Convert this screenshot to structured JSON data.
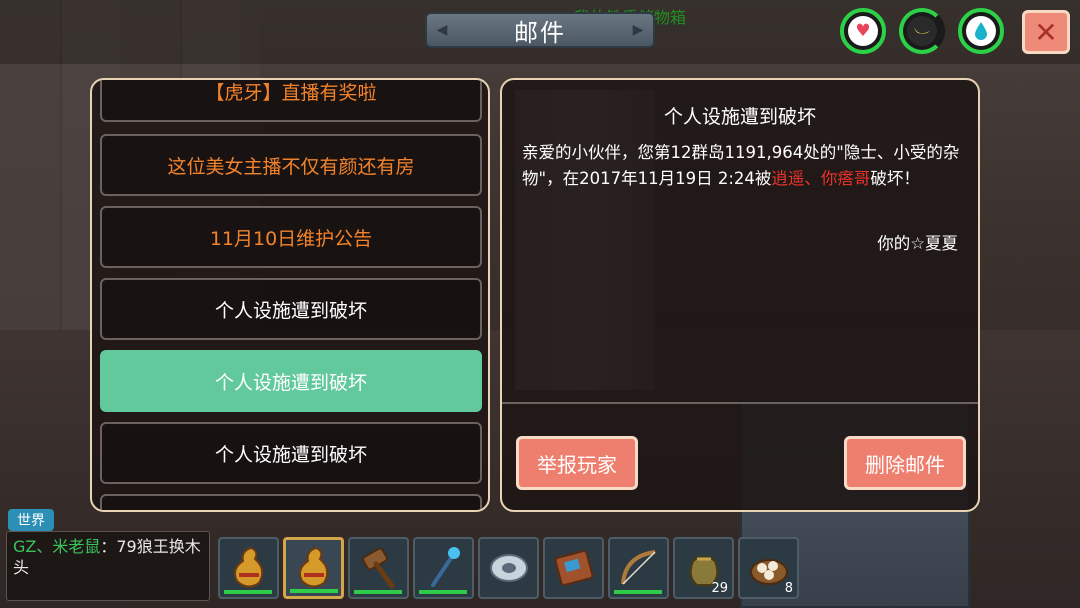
{
  "scene": {
    "storage_label": "我的铁质储物箱"
  },
  "header": {
    "title": "邮件"
  },
  "status_icons": [
    "heart-icon",
    "banana-icon",
    "water-drop-icon"
  ],
  "close_icon": "close-icon",
  "mail_list": [
    {
      "subject": "【虎牙】直播有奖啦",
      "color": "#f3832a"
    },
    {
      "subject": "这位美女主播不仅有颜还有房",
      "color": "#f3832a"
    },
    {
      "subject": "11月10日维护公告",
      "color": "#f3832a"
    },
    {
      "subject": "个人设施遭到破坏",
      "color": "#ffffff"
    },
    {
      "subject": "个人设施遭到破坏",
      "color": "#ffffff",
      "selected": true
    },
    {
      "subject": "个人设施遭到破坏",
      "color": "#ffffff"
    }
  ],
  "detail": {
    "title": "个人设施遭到破坏",
    "body_part1": "亲爱的小伙伴，您第12群岛1191,964处的\"隐士、小受的杂物\"，在2017年11月19日 2:24被",
    "body_attacker": "逍遥、你瘩哥",
    "body_part2": "破坏！",
    "signature": "你的☆夏夏",
    "report_label": "举报玩家",
    "delete_label": "删除邮件"
  },
  "chat": {
    "tab_label": "世界",
    "user": "GZ、米老鼠",
    "message": "：79狼王换木头"
  },
  "hotbar": [
    {
      "item": "gourd-icon",
      "durability": true
    },
    {
      "item": "gourd-icon",
      "durability": true,
      "selected": true
    },
    {
      "item": "hammer-icon",
      "durability": true
    },
    {
      "item": "staff-icon",
      "durability": true
    },
    {
      "item": "disc-icon"
    },
    {
      "item": "book-icon"
    },
    {
      "item": "bow-icon",
      "durability": true
    },
    {
      "item": "seed-bag-icon",
      "count": "29"
    },
    {
      "item": "dumpling-icon",
      "count": "8"
    }
  ],
  "colors": {
    "accent_green": "#62c99c",
    "button_red": "#ee7e6e",
    "highlight_orange": "#f3832a",
    "alert_red": "#e8322a",
    "stat_ring": "#2cd148"
  }
}
